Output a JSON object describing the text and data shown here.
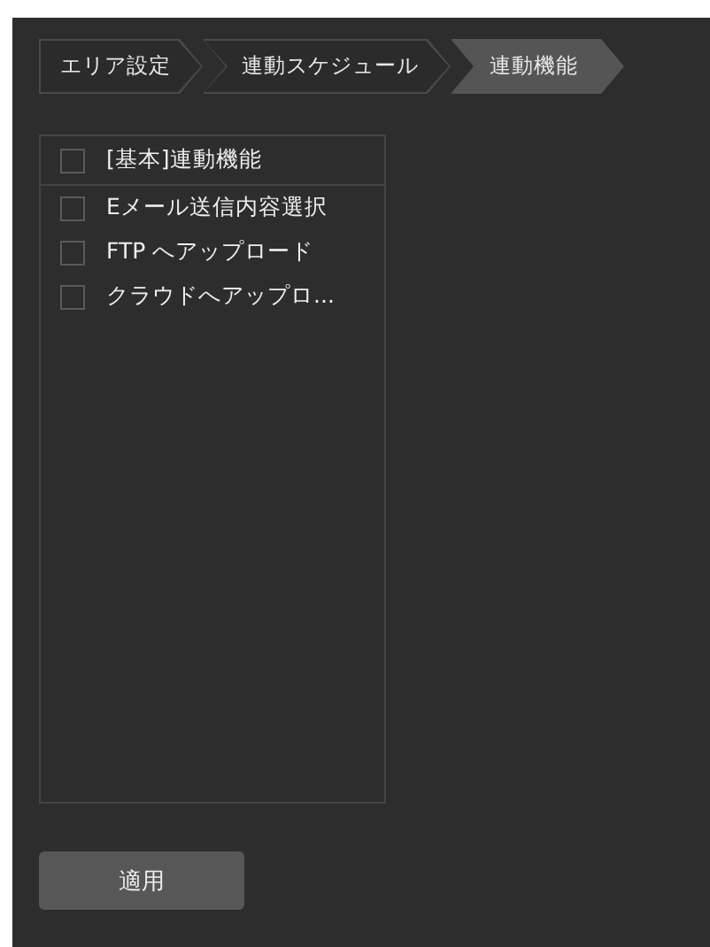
{
  "breadcrumb": [
    {
      "label": "エリア設定",
      "selected": false
    },
    {
      "label": "連動スケジュール",
      "selected": false
    },
    {
      "label": "連動機能",
      "selected": true
    }
  ],
  "list": {
    "header": {
      "label": "[基本]連動機能",
      "checked": false
    },
    "items": [
      {
        "label": "Eメール送信内容選択",
        "checked": false
      },
      {
        "label": "FTP へアップロード",
        "checked": false
      },
      {
        "label": "クラウドへアップロ...",
        "checked": false
      }
    ]
  },
  "apply_button": "適用"
}
